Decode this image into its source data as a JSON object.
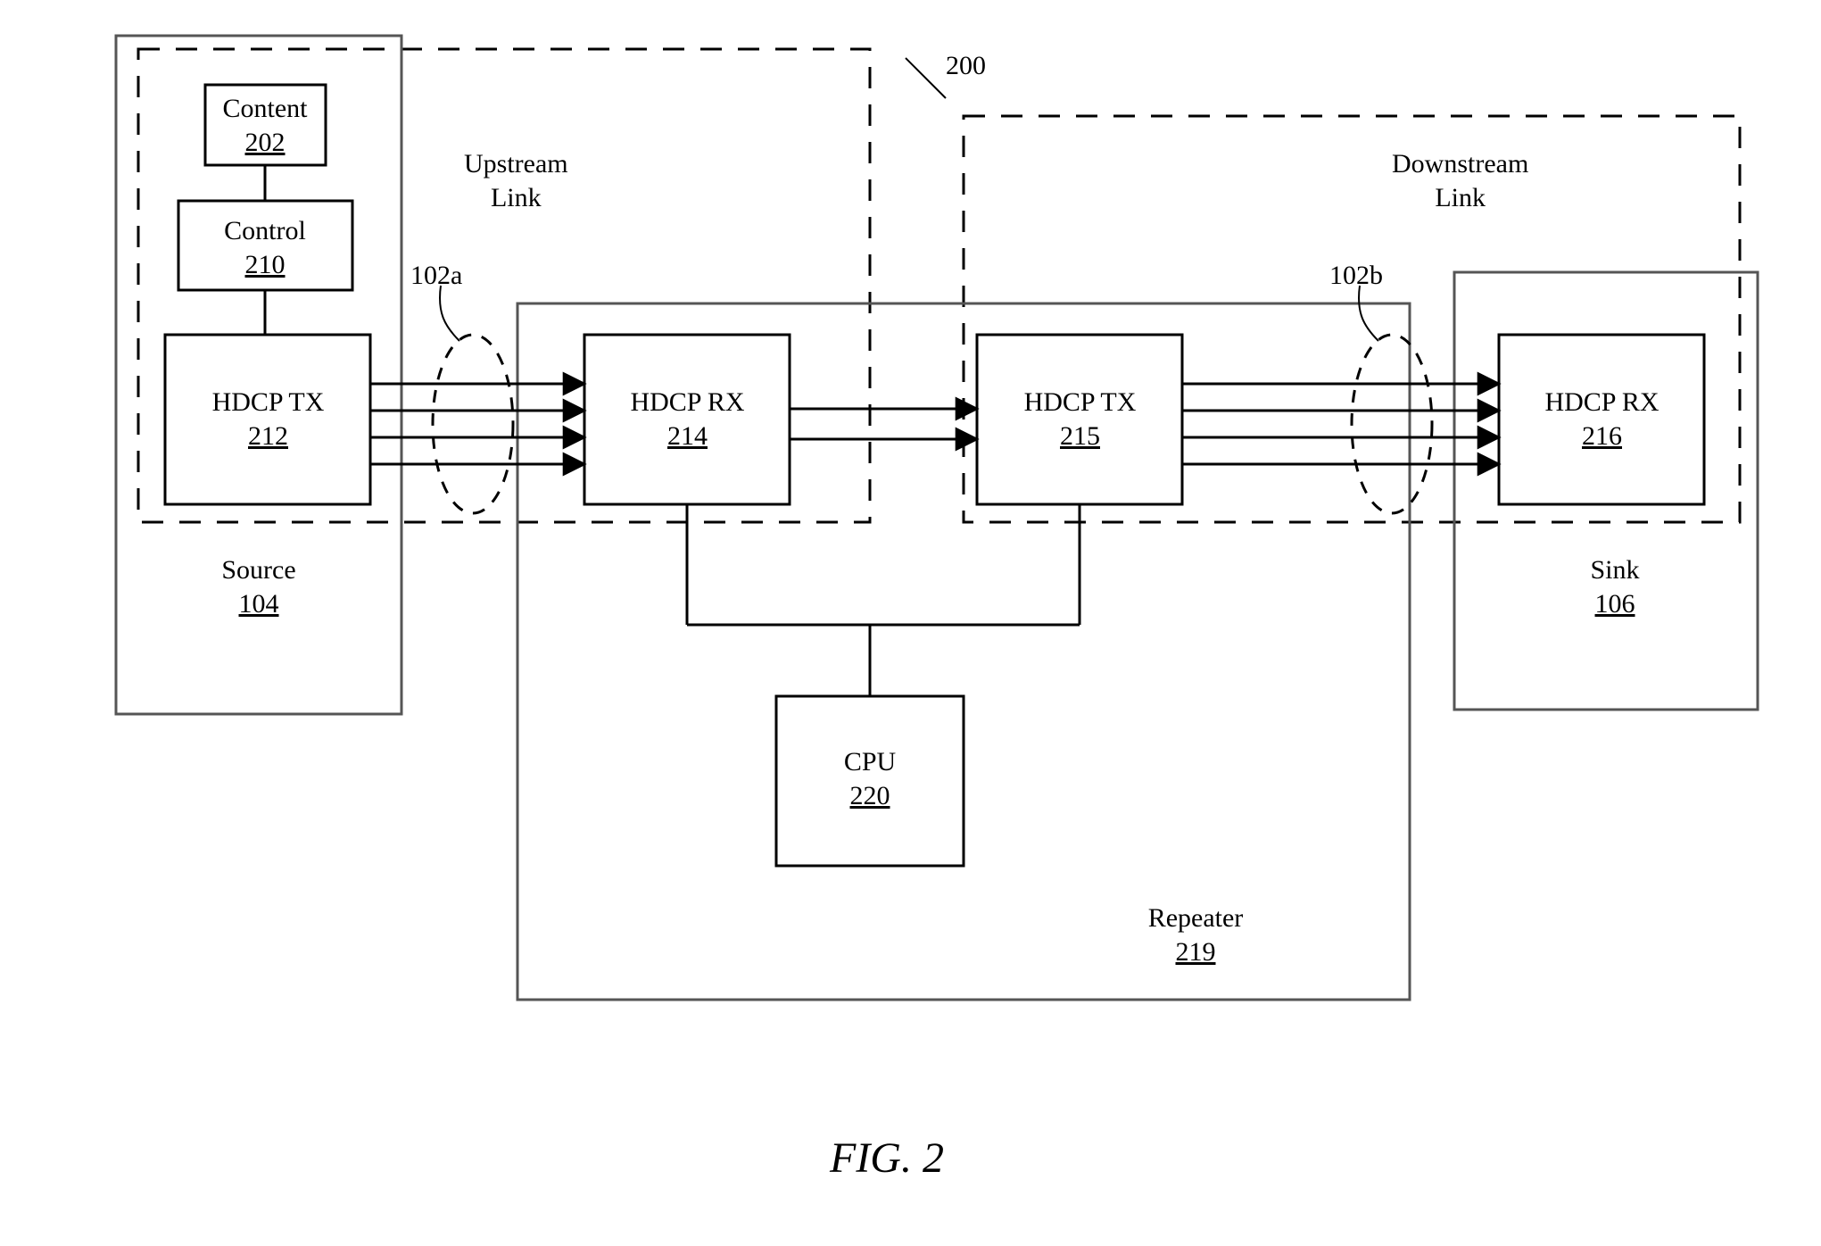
{
  "figure": {
    "caption": "FIG. 2",
    "system_ref": "200"
  },
  "labels": {
    "upstream_link": "Upstream\nLink",
    "downstream_link": "Downstream\nLink",
    "link_a": "102a",
    "link_b": "102b"
  },
  "source": {
    "title": "Source",
    "ref": "104",
    "content": {
      "title": "Content",
      "ref": "202"
    },
    "control": {
      "title": "Control",
      "ref": "210"
    },
    "hdcp_tx": {
      "title": "HDCP TX",
      "ref": "212"
    }
  },
  "repeater": {
    "title": "Repeater",
    "ref": "219",
    "hdcp_rx": {
      "title": "HDCP RX",
      "ref": "214"
    },
    "hdcp_tx": {
      "title": "HDCP TX",
      "ref": "215"
    },
    "cpu": {
      "title": "CPU",
      "ref": "220"
    }
  },
  "sink": {
    "title": "Sink",
    "ref": "106",
    "hdcp_rx": {
      "title": "HDCP RX",
      "ref": "216"
    }
  }
}
